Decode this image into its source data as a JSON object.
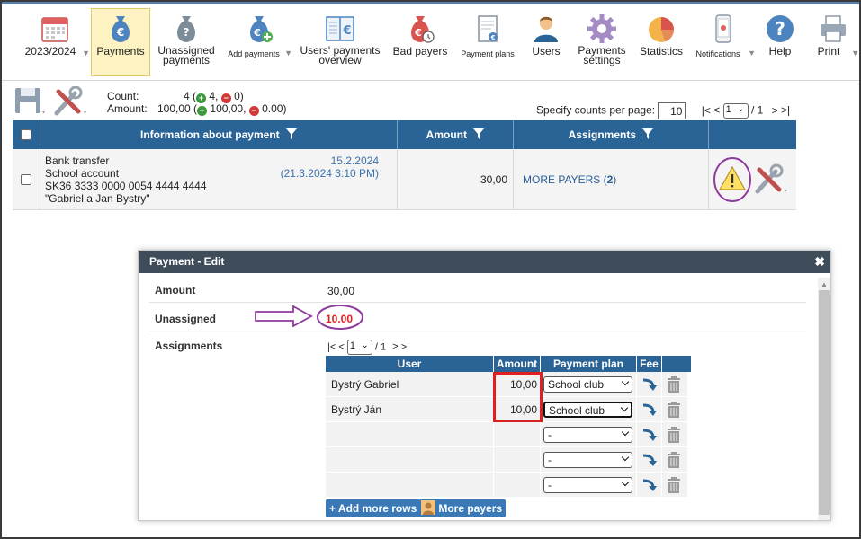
{
  "toolbar": {
    "items": [
      {
        "label": "2023/2024",
        "icon": "calendar-icon"
      },
      {
        "label": "Payments",
        "icon": "money-bag-icon"
      },
      {
        "label": "Unassigned payments",
        "icon": "unassigned-money-bag-icon"
      },
      {
        "label": "Add payments",
        "icon": "add-money-bag-icon"
      },
      {
        "label": "Users' payments overview",
        "icon": "ledger-icon"
      },
      {
        "label": "Bad payers",
        "icon": "bad-payers-icon"
      },
      {
        "label": "Payment plans",
        "icon": "payment-plan-icon"
      },
      {
        "label": "Users",
        "icon": "user-icon"
      },
      {
        "label": "Payments settings",
        "icon": "gear-icon"
      },
      {
        "label": "Statistics",
        "icon": "pie-chart-icon"
      },
      {
        "label": "Notifications",
        "icon": "phone-icon"
      },
      {
        "label": "Help",
        "icon": "help-icon"
      },
      {
        "label": "Print",
        "icon": "printer-icon"
      }
    ]
  },
  "summary": {
    "count_label": "Count:",
    "count_value": "4",
    "count_green": "4,",
    "count_red": "0)",
    "amount_label": "Amount:",
    "amount_value": "100,00",
    "amount_green": "100,00,",
    "amount_red": "0.00)",
    "open_paren": "(",
    "plus": "+",
    "minus": "−"
  },
  "pager": {
    "counts_label": "Specify counts per page:",
    "counts_value": "10",
    "first": "|<",
    "prev": "<",
    "page": "1",
    "of": "/ 1",
    "next": ">",
    "last": ">|"
  },
  "main_table": {
    "headers": {
      "info": "Information about payment",
      "amount": "Amount",
      "assignments": "Assignments"
    },
    "row": {
      "line1": "Bank transfer",
      "line2": "School account",
      "line3": "SK36 3333 0000 0054 4444 4444",
      "line4": "\"Gabriel a Jan Bystry\"",
      "date": "15.2.2024",
      "datetime": "(21.3.2024 3:10 PM)",
      "amount": "30,00",
      "payers_label": "MORE PAYERS (",
      "payers_count": "2",
      "payers_close": ")"
    }
  },
  "modal": {
    "title": "Payment - Edit",
    "close": "✖",
    "amount_label": "Amount",
    "amount_value": "30,00",
    "unassigned_label": "Unassigned",
    "unassigned_value": "10.00",
    "assignments_label": "Assignments",
    "pager": {
      "first": "|<",
      "prev": "<",
      "page": "1",
      "of": "/ 1",
      "next": ">",
      "last": ">|"
    },
    "headers": {
      "user": "User",
      "amount": "Amount",
      "plan": "Payment plan",
      "fee": "Fee"
    },
    "rows": [
      {
        "user": "Bystrý Gabriel",
        "amount": "10,00",
        "plan": "School club"
      },
      {
        "user": "Bystrý Ján",
        "amount": "10,00",
        "plan": "School club"
      },
      {
        "user": "",
        "amount": "",
        "plan": "-"
      },
      {
        "user": "",
        "amount": "",
        "plan": "-"
      },
      {
        "user": "",
        "amount": "",
        "plan": "-"
      }
    ],
    "add_rows_button": "+ Add more rows",
    "more_payers_button": "More payers"
  },
  "colors": {
    "header_blue": "#2a6496",
    "highlight_purple": "#8e3a9e",
    "highlight_red": "#e02020",
    "active_yellow": "#fdf2c2"
  }
}
